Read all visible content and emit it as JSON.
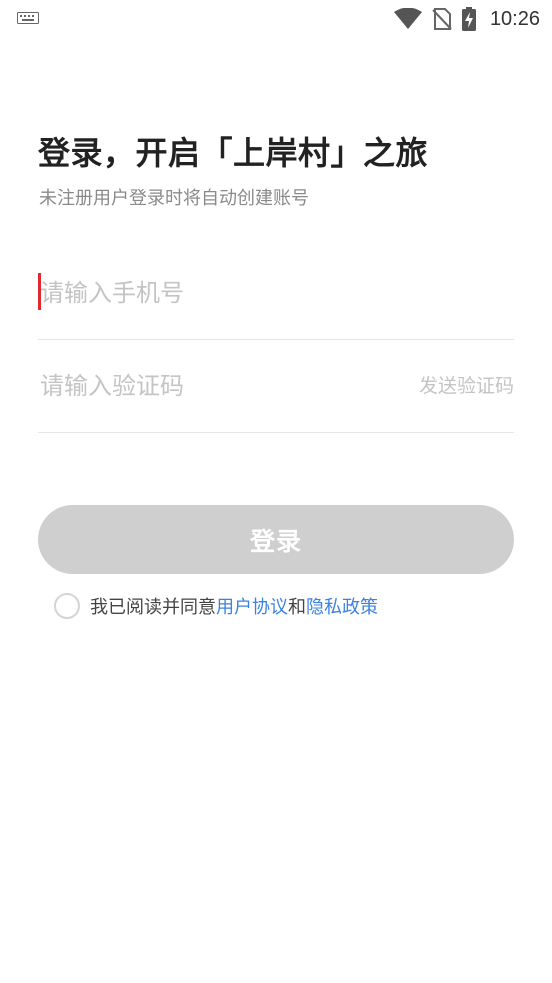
{
  "status_bar": {
    "time": "10:26",
    "icons": [
      "keyboard-icon",
      "wifi-icon",
      "no-sim-icon",
      "battery-charging-icon"
    ]
  },
  "header": {
    "title": "登录，开启「上岸村」之旅",
    "subtitle": "未注册用户登录时将自动创建账号"
  },
  "form": {
    "phone_placeholder": "请输入手机号",
    "phone_value": "",
    "code_placeholder": "请输入验证码",
    "code_value": "",
    "send_code_label": "发送验证码",
    "login_label": "登录"
  },
  "agreement": {
    "checked": false,
    "prefix": "我已阅读并同意",
    "user_agreement": "用户协议",
    "and": "和",
    "privacy_policy": "隐私政策"
  },
  "colors": {
    "accent_link": "#3b82e0",
    "caret": "#e0282e",
    "button_disabled": "#cfcfcf",
    "placeholder": "#c4c4c4"
  }
}
